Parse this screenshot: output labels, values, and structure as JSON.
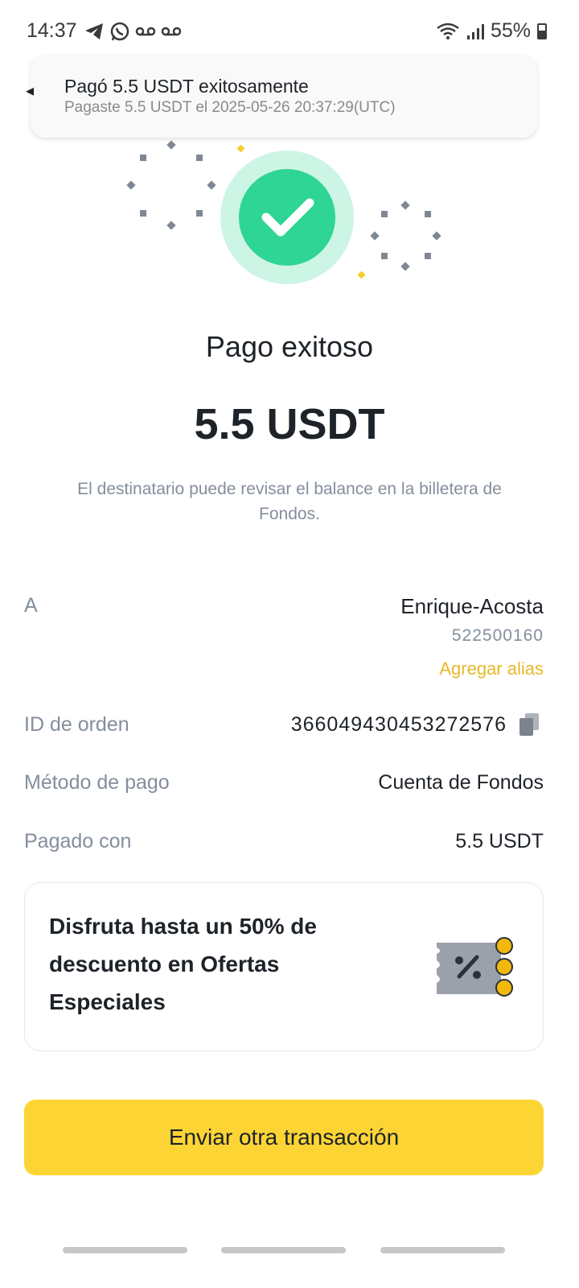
{
  "status_bar": {
    "time": "14:37",
    "battery": "55%",
    "left_icons": [
      "telegram-icon",
      "whatsapp-icon",
      "voicemail-icon",
      "voicemail-icon"
    ],
    "right_icons": [
      "wifi-icon",
      "signal-icon",
      "battery-icon"
    ]
  },
  "toast": {
    "title": "Pagó 5.5 USDT exitosamente",
    "subtitle": "Pagaste 5.5 USDT el 2025-05-26 20:37:29(UTC)"
  },
  "success": {
    "headline": "Pago exitoso",
    "amount": "5.5 USDT",
    "note": "El destinatario puede revisar el balance en la billetera de Fondos.",
    "icon": "check-icon",
    "colors": {
      "success_green": "#2ed594",
      "success_ring": "#cdf5e5"
    }
  },
  "details": {
    "to_label": "A",
    "recipient_name": "Enrique-Acosta",
    "recipient_id": "522500160",
    "add_alias": "Agregar alias",
    "order_label": "ID de orden",
    "order_id": "366049430453272576",
    "method_label": "Método de pago",
    "method_value": "Cuenta de Fondos",
    "paid_label": "Pagado con",
    "paid_value": "5.5 USDT"
  },
  "promo": {
    "text": "Disfruta hasta un 50% de descuento en Ofertas Especiales",
    "icon": "discount-coupon-icon"
  },
  "cta": {
    "label": "Enviar otra transacción",
    "color": "#fcd535"
  },
  "accent": "#e8b82a"
}
